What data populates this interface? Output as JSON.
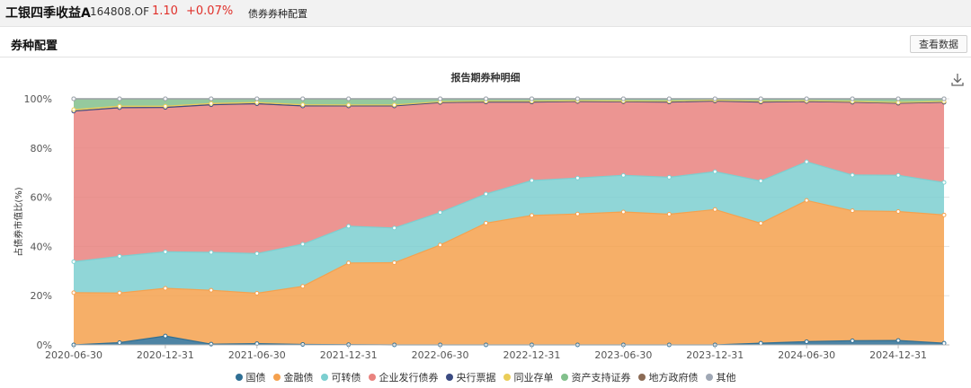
{
  "header": {
    "fund_name": "工银四季收益A",
    "fund_code": "164808.OF",
    "price": "1.10",
    "change": "+0.07%",
    "tab": "债券券种配置"
  },
  "section": {
    "title": "券种配置",
    "view_data_label": "查看数据"
  },
  "chart_data": {
    "type": "area",
    "stacked": true,
    "title": "报告期券种明细",
    "ylabel": "占债券市值比(%)",
    "xlabel": "",
    "ylim": [
      0,
      100
    ],
    "yticks": [
      "0%",
      "20%",
      "40%",
      "60%",
      "80%",
      "100%"
    ],
    "x": [
      "2020-06-30",
      "2020-09-30",
      "2020-12-31",
      "2021-03-31",
      "2021-06-30",
      "2021-09-30",
      "2021-12-31",
      "2022-03-31",
      "2022-06-30",
      "2022-09-30",
      "2022-12-31",
      "2023-03-31",
      "2023-06-30",
      "2023-09-30",
      "2023-12-31",
      "2024-03-31",
      "2024-06-30",
      "2024-09-30",
      "2024-12-31",
      "2025-03-31"
    ],
    "xtick_labels": [
      "2020-06-30",
      "2020-12-31",
      "2021-06-30",
      "2021-12-31",
      "2022-06-30",
      "2022-12-31",
      "2023-06-30",
      "2023-12-31",
      "2024-06-30",
      "2024-12-31"
    ],
    "grid": true,
    "legend_position": "bottom",
    "series": [
      {
        "name": "国债",
        "color": "#2f6f94",
        "values": [
          0.0,
          0.9,
          3.6,
          0.3,
          0.5,
          0.2,
          0.1,
          0.0,
          0.0,
          0.0,
          0.0,
          0.0,
          0.0,
          0.0,
          0.0,
          0.7,
          1.3,
          1.7,
          1.8,
          0.7
        ]
      },
      {
        "name": "金融债",
        "color": "#f5a14e",
        "values": [
          21.2,
          20.2,
          19.4,
          21.9,
          20.5,
          23.6,
          33.2,
          33.4,
          40.6,
          49.5,
          52.6,
          53.2,
          54.0,
          53.1,
          55.0,
          48.7,
          57.4,
          52.8,
          52.4,
          52.1
        ]
      },
      {
        "name": "可转债",
        "color": "#7ccfd0",
        "values": [
          12.6,
          14.9,
          14.8,
          15.4,
          16.1,
          17.1,
          14.9,
          14.1,
          13.2,
          11.8,
          14.2,
          14.6,
          14.9,
          15.0,
          15.4,
          17.2,
          15.7,
          14.5,
          14.7,
          13.2
        ]
      },
      {
        "name": "企业发行债券",
        "color": "#e9837f",
        "values": [
          61.2,
          60.4,
          58.7,
          60.0,
          60.9,
          56.2,
          48.9,
          49.6,
          44.7,
          37.4,
          31.9,
          31.1,
          29.9,
          30.6,
          28.7,
          32.1,
          24.5,
          29.6,
          29.3,
          32.6
        ]
      },
      {
        "name": "央行票据",
        "color": "#3b4b82",
        "values": [
          0,
          0,
          0,
          0,
          0,
          0,
          0,
          0,
          0,
          0,
          0,
          0,
          0,
          0,
          0,
          0,
          0,
          0,
          0,
          0
        ]
      },
      {
        "name": "同业存单",
        "color": "#eacd58",
        "values": [
          0.6,
          0.6,
          0.5,
          0.5,
          0.5,
          0.5,
          0.4,
          0.4,
          0.3,
          0.3,
          0.3,
          0.3,
          0.3,
          0.3,
          0.3,
          0.3,
          0.3,
          0.3,
          0.3,
          0.3
        ]
      },
      {
        "name": "资产支持证券",
        "color": "#82c08c",
        "values": [
          4.4,
          3.0,
          3.0,
          1.9,
          1.5,
          2.4,
          2.5,
          2.5,
          1.2,
          1.0,
          1.0,
          0.8,
          0.9,
          1.0,
          0.6,
          1.0,
          0.8,
          1.1,
          1.5,
          1.1
        ]
      },
      {
        "name": "地方政府债",
        "color": "#8b6b55",
        "values": [
          0,
          0,
          0,
          0,
          0,
          0,
          0,
          0,
          0,
          0,
          0,
          0,
          0,
          0,
          0,
          0,
          0,
          0,
          0,
          0
        ]
      },
      {
        "name": "其他",
        "color": "#a0a8b5",
        "values": [
          0,
          0,
          0,
          0,
          0,
          0,
          0,
          0,
          0,
          0,
          0,
          0,
          0,
          0,
          0,
          0,
          0,
          0,
          0,
          0
        ]
      }
    ]
  },
  "icons": {
    "download": "download-icon"
  }
}
